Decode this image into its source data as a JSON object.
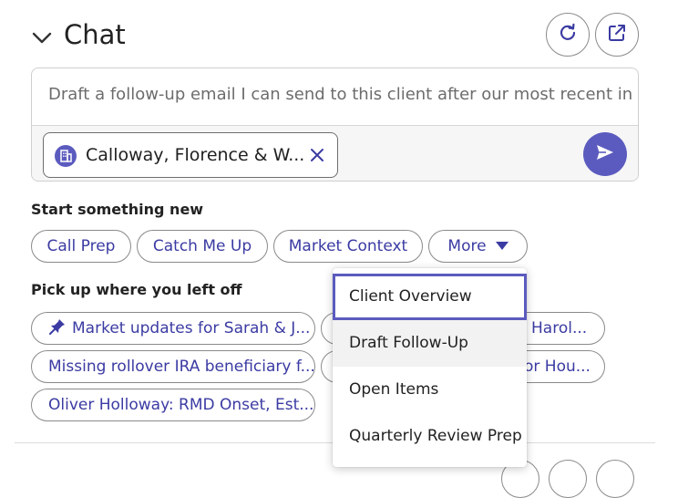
{
  "header": {
    "title": "Chat",
    "collapse_icon": "chevron-down-icon",
    "refresh_icon": "refresh-icon",
    "popout_icon": "external-link-icon"
  },
  "composer": {
    "placeholder": "Draft a follow-up email I can send to this client after our most recent in...",
    "client_chip_label": "Calloway, Florence & W...",
    "client_chip_icon": "building-icon",
    "remove_icon": "close-icon",
    "send_icon": "send-icon"
  },
  "start_section": {
    "label": "Start something new",
    "actions": [
      "Call Prep",
      "Catch Me Up",
      "Market Context"
    ],
    "more_label": "More"
  },
  "resume_section": {
    "label": "Pick up where you left off",
    "items": [
      "Market updates for Sarah & J...",
      "Harol...",
      "Missing rollover IRA beneficiary f...",
      "or Hou...",
      "Oliver Holloway: RMD Onset, Est..."
    ]
  },
  "more_menu": {
    "items": [
      "Client Overview",
      "Draft Follow-Up",
      "Open Items",
      "Quarterly Review Prep"
    ]
  },
  "colors": {
    "accent": "#5b5bbf",
    "link_text": "#3b3ba3",
    "border": "#8a8a8a"
  }
}
